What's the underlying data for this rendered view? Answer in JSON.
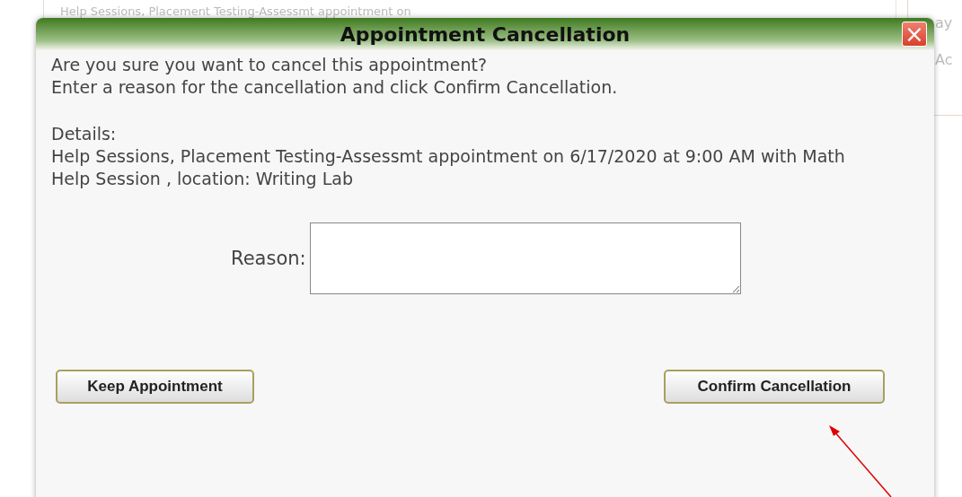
{
  "background": {
    "list_text": "Help Sessions, Placement Testing-Assessmt appointment on",
    "side_texts": [
      "ay",
      "Ac"
    ]
  },
  "dialog": {
    "title": "Appointment Cancellation",
    "close_icon": "×",
    "intro": [
      "Are you sure you want to cancel this appointment?",
      "Enter a reason for the cancellation and click Confirm Cancellation."
    ],
    "details_label": "Details:",
    "details": "Help Sessions, Placement Testing-Assessmt appointment on 6/17/2020 at 9:00 AM with Math Help Session , location: Writing Lab",
    "reason_label": "Reason:",
    "buttons": [
      {
        "label": "Keep Appointment",
        "kind": "keep"
      },
      {
        "label": "Confirm Cancellation",
        "kind": "confirm"
      }
    ]
  }
}
